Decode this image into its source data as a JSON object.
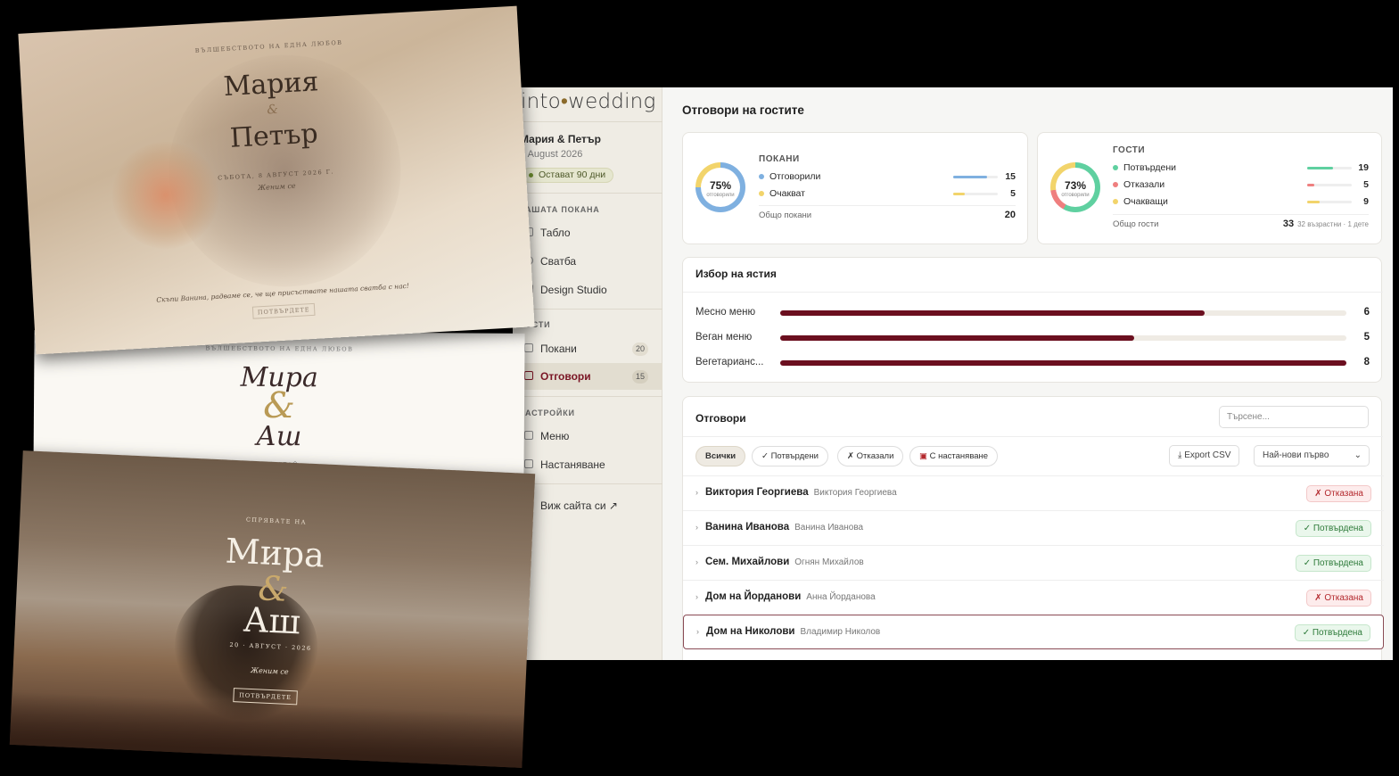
{
  "app": {
    "logo_left": "into",
    "logo_dot": "•",
    "logo_right": "wedding"
  },
  "sidebar": {
    "couple": "Мария & Петър",
    "date": "8 August 2026",
    "days_left": "Остават 90 дни",
    "section_invite": "АШАТА ПОКАНА",
    "items_invite": [
      {
        "label": "Табло",
        "icon": "grid-icon"
      },
      {
        "label": "Сватба",
        "icon": "heart-icon"
      },
      {
        "label": "Design Studio",
        "icon": "palette-icon"
      }
    ],
    "section_guests": "ОСТИ",
    "items_guests": [
      {
        "label": "Покани",
        "count": "20",
        "icon": "envelope-icon"
      },
      {
        "label": "Отговори",
        "count": "15",
        "icon": "chat-icon",
        "active": true
      }
    ],
    "section_settings": "АСТРОЙКИ",
    "items_settings": [
      {
        "label": "Меню",
        "icon": "menu-icon"
      },
      {
        "label": "Настаняване",
        "icon": "seat-icon"
      }
    ],
    "view_site": "Виж сайта си ↗"
  },
  "main": {
    "title": "Отговори на гостите",
    "invites_card": {
      "percent": "75%",
      "percent_sub": "отговорили",
      "heading": "ПОКАНИ",
      "rows": [
        {
          "name": "Отговорили",
          "value": "15",
          "color": "#7fb0e0",
          "fraction": 0.75
        },
        {
          "name": "Очакват",
          "value": "5",
          "color": "#f2d46b",
          "fraction": 0.25
        }
      ],
      "total_label": "Общо покани",
      "total_value": "20"
    },
    "guests_card": {
      "percent": "73%",
      "percent_sub": "отговорили",
      "heading": "ГОСТИ",
      "rows": [
        {
          "name": "Потвърдени",
          "value": "19",
          "color": "#5fd0a0",
          "fraction": 0.58
        },
        {
          "name": "Отказали",
          "value": "5",
          "color": "#ef7f7f",
          "fraction": 0.15
        },
        {
          "name": "Очакващи",
          "value": "9",
          "color": "#f2d46b",
          "fraction": 0.27
        }
      ],
      "total_label": "Общо гости",
      "total_value": "33",
      "total_note": "32 възрастни · 1 дете"
    },
    "meals": {
      "title": "Избор на ястия",
      "max": 8,
      "rows": [
        {
          "name": "Месно меню",
          "value": 6
        },
        {
          "name": "Веган меню",
          "value": 5
        },
        {
          "name": "Вегетарианс...",
          "value": 8
        }
      ]
    },
    "responses": {
      "title": "Отговори",
      "search_placeholder": "Търсене...",
      "filters": [
        "Всички",
        "✓ Потвърдени",
        "✗ Отказали",
        "С настаняване"
      ],
      "export": "Export CSV",
      "sort": "Най-нови първо",
      "rows": [
        {
          "name": "Виктория Георгиева",
          "sub": "Виктория Георгиева",
          "status": "✗ Отказана",
          "ok": false
        },
        {
          "name": "Ванина Иванова",
          "sub": "Ванина Иванова",
          "status": "✓ Потвърдена",
          "ok": true
        },
        {
          "name": "Сем. Михайлови",
          "sub": "Огнян Михайлов",
          "status": "✓ Потвърдена",
          "ok": true
        },
        {
          "name": "Дом на Йорданови",
          "sub": "Анна Йорданова",
          "status": "✗ Отказана",
          "ok": false
        },
        {
          "name": "Дом на Николови",
          "sub": "Владимир Николов",
          "status": "✓ Потвърдена",
          "ok": true
        }
      ]
    }
  },
  "site1": {
    "tagline": "ВЪЛШЕБСТВОТО НА ЕДНА ЛЮБОВ",
    "name1": "Мария",
    "amp": "&",
    "name2": "Петър",
    "date": "СЪБОТА, 8 АВГУСТ 2026 Г.",
    "script": "Женим се",
    "invite_text": "Скъпи Ванина, радваме се, че ще присъствате нашата сватба с нас!",
    "button": "ПОТВЪРДЕТЕ"
  },
  "site2": {
    "tagline": "ВЪЛШЕБСТВОТО НА ЕДНА ЛЮБОВ",
    "name1": "Мира",
    "amp": "&",
    "name2": "Аш",
    "small": "ОТГЪРТАЙ"
  },
  "site3": {
    "tagline": "СПРЯВАТЕ НА",
    "name1": "Мира",
    "amp": "&",
    "name2": "Аш",
    "date": "20 · АВГУСТ · 2026",
    "script": "Женим се",
    "button": "ПОТВЪРДЕТЕ"
  }
}
